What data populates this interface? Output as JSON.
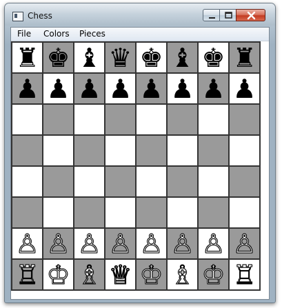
{
  "window": {
    "title": "Chess",
    "controls": {
      "minimize_icon": "minimize-icon",
      "maximize_icon": "maximize-icon",
      "close_icon": "close-icon"
    }
  },
  "menu": [
    {
      "label": "File"
    },
    {
      "label": "Colors"
    },
    {
      "label": "Pieces"
    }
  ],
  "board": {
    "light_color": "#ffffff",
    "dark_color": "#9a9a9a",
    "rows": [
      [
        "♜",
        "♚",
        "♝",
        "♛",
        "♚",
        "♝",
        "♚",
        "♜"
      ],
      [
        "♟",
        "♟",
        "♟",
        "♟",
        "♟",
        "♟",
        "♟",
        "♟"
      ],
      [
        "",
        "",
        "",
        "",
        "",
        "",
        "",
        ""
      ],
      [
        "",
        "",
        "",
        "",
        "",
        "",
        "",
        ""
      ],
      [
        "",
        "",
        "",
        "",
        "",
        "",
        "",
        ""
      ],
      [
        "",
        "",
        "",
        "",
        "",
        "",
        "",
        ""
      ],
      [
        "♙",
        "♙",
        "♙",
        "♙",
        "♙",
        "♙",
        "♙",
        "♙"
      ],
      [
        "♖",
        "♔",
        "♗",
        "♕",
        "♔",
        "♗",
        "♔",
        "♖"
      ]
    ],
    "piece_colors": [
      "black",
      "black",
      "",
      "",
      "",
      "",
      "white",
      "white"
    ]
  }
}
